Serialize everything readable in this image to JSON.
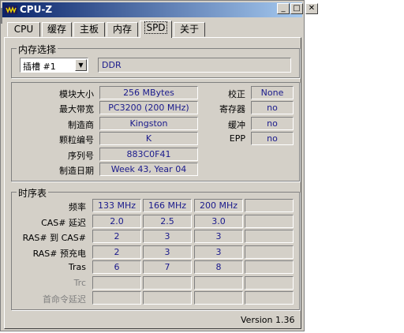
{
  "window": {
    "title": "CPU-Z"
  },
  "titlebar_buttons": [
    {
      "name": "minimize-button",
      "glyph": "_"
    },
    {
      "name": "maximize-button",
      "glyph": "□"
    },
    {
      "name": "close-button",
      "glyph": "✕"
    }
  ],
  "tabs": [
    "CPU",
    "缓存",
    "主板",
    "内存",
    "SPD",
    "关于"
  ],
  "active_tab": "SPD",
  "memory_select": {
    "group_label": "内存选择",
    "slot": "插槽 #1",
    "type": "DDR"
  },
  "module": {
    "rows": [
      {
        "label": "模块大小",
        "value": "256 MBytes"
      },
      {
        "label": "最大带宽",
        "value": "PC3200 (200 MHz)"
      },
      {
        "label": "制造商",
        "value": "Kingston"
      },
      {
        "label": "颗粒编号",
        "value": "K"
      },
      {
        "label": "序列号",
        "value": "883C0F41"
      },
      {
        "label": "制造日期",
        "value": "Week 43, Year 04"
      }
    ],
    "flags": [
      {
        "label": "校正",
        "value": "None"
      },
      {
        "label": "寄存器",
        "value": "no"
      },
      {
        "label": "缓冲",
        "value": "no"
      },
      {
        "label": "EPP",
        "value": "no"
      }
    ]
  },
  "timings": {
    "group_label": "时序表",
    "rows": [
      {
        "label": "频率",
        "values": [
          "133 MHz",
          "166 MHz",
          "200 MHz",
          ""
        ],
        "disabled": false
      },
      {
        "label": "CAS# 延迟",
        "values": [
          "2.0",
          "2.5",
          "3.0",
          ""
        ],
        "disabled": false
      },
      {
        "label": "RAS# 到 CAS#",
        "values": [
          "2",
          "3",
          "3",
          ""
        ],
        "disabled": false
      },
      {
        "label": "RAS# 预充电",
        "values": [
          "2",
          "3",
          "3",
          ""
        ],
        "disabled": false
      },
      {
        "label": "Tras",
        "values": [
          "6",
          "7",
          "8",
          ""
        ],
        "disabled": false
      },
      {
        "label": "Trc",
        "values": [
          "",
          "",
          "",
          ""
        ],
        "disabled": true
      },
      {
        "label": "首命令延迟",
        "values": [
          "",
          "",
          "",
          ""
        ],
        "disabled": true
      }
    ]
  },
  "version": "Version 1.36",
  "colors": {
    "title_start": "#0a246a",
    "title_end": "#a6caf0",
    "value_text": "#1a1a8c",
    "face": "#d4d0c8"
  }
}
